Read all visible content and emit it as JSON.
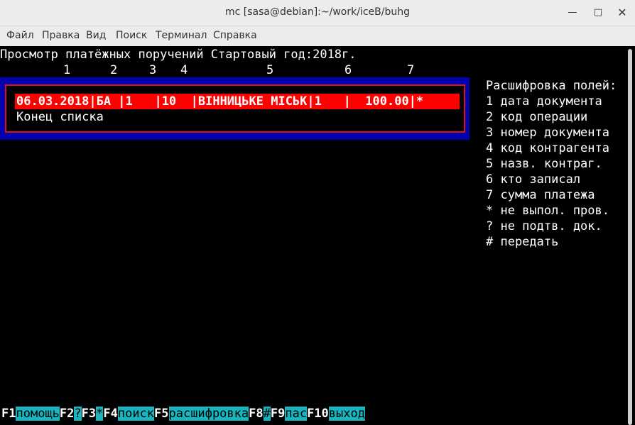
{
  "window": {
    "title": "mc [sasa@debian]:~/work/iceB/buhg"
  },
  "menu": {
    "items": [
      "Файл",
      "Правка",
      "Вид",
      "Поиск",
      "Терминал",
      "Справка"
    ]
  },
  "screen": {
    "header": "Просмотр платёжных поручений Стартовый год:2018г.",
    "column_numbers": [
      "1",
      "2",
      "3",
      "4",
      "5",
      "6",
      "7"
    ],
    "list": {
      "rows": [
        {
          "text": "06.03.2018|БА |1   |10  |ВІННИЦЬКЕ МІСЬК|1   |  100.00|*",
          "selected": true
        }
      ],
      "end_marker": "Конец списка"
    },
    "legend": {
      "title": "Расшифровка полей:",
      "items": [
        "1 дата документа",
        "2 код операции",
        "3 номер документа",
        "4 код контрагента",
        "5 назв. контраг.",
        "6 кто записал",
        "7 сумма платежа",
        "* не выпол. пров.",
        "? не подтв. док.",
        "# передать"
      ]
    }
  },
  "fkeys": [
    {
      "key": "F1",
      "label": "помощь"
    },
    {
      "key": "F2",
      "label": "?"
    },
    {
      "key": "F3",
      "label": "*"
    },
    {
      "key": "F4",
      "label": "поиск"
    },
    {
      "key": "F5",
      "label": "расшифровка"
    },
    {
      "key": "F8",
      "label": "#"
    },
    {
      "key": "F9",
      "label": "пас"
    },
    {
      "key": "F10",
      "label": "выход"
    }
  ],
  "colors": {
    "selection": "#ff0000",
    "frame_blue": "#0000b0",
    "frame_red": "#e01010",
    "fkey_label": "#17b5c0"
  }
}
